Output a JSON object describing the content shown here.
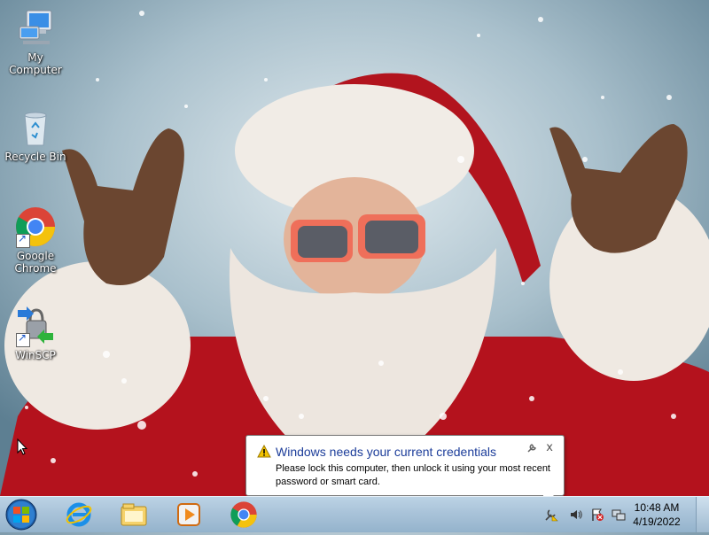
{
  "desktop": {
    "icons": [
      {
        "label": "My Computer",
        "icon": "computer-icon"
      },
      {
        "label": "Recycle Bin",
        "icon": "recycle-bin-icon"
      },
      {
        "label": "Google Chrome",
        "icon": "chrome-icon"
      },
      {
        "label": "WinSCP",
        "icon": "winscp-icon"
      }
    ]
  },
  "notification": {
    "title": "Windows needs your current credentials",
    "message": "Please lock this computer, then unlock it using your most recent password or smart card.",
    "icon": "warning-icon",
    "close_glyph": "x"
  },
  "taskbar": {
    "pinned": [
      {
        "name": "Internet Explorer",
        "icon": "internet-explorer-icon"
      },
      {
        "name": "Windows Explorer",
        "icon": "file-explorer-icon"
      },
      {
        "name": "Windows Media Player",
        "icon": "media-player-icon"
      },
      {
        "name": "Google Chrome",
        "icon": "chrome-icon"
      }
    ],
    "tray": {
      "time": "10:48 AM",
      "date": "4/19/2022"
    }
  },
  "colors": {
    "taskbar": "#a9c3d9",
    "notification_title": "#1c3d9a"
  }
}
